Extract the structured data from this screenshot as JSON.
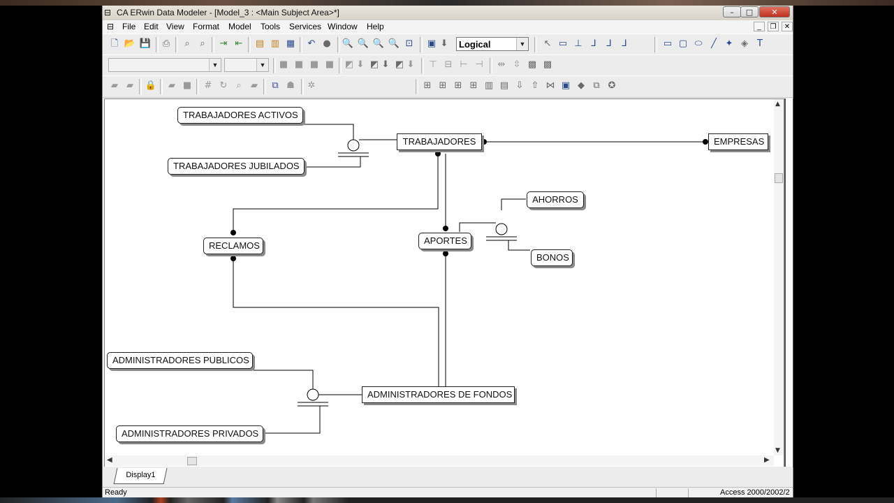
{
  "window": {
    "title": "CA ERwin Data Modeler - [Model_3 : <Main Subject Area>*]",
    "controls": {
      "minimize": "–",
      "maximize": "□",
      "close": "✕"
    }
  },
  "menu": [
    "File",
    "Edit",
    "View",
    "Format",
    "Model",
    "Tools",
    "Services",
    "Window",
    "Help"
  ],
  "toolbar": {
    "view_mode": "Logical",
    "font_combo": "",
    "size_combo": ""
  },
  "diagram": {
    "entities": {
      "trabajadores_activos": "TRABAJADORES ACTIVOS",
      "trabajadores_jubilados": "TRABAJADORES JUBILADOS",
      "trabajadores": "TRABAJADORES",
      "empresas": "EMPRESAS",
      "ahorros": "AHORROS",
      "bonos": "BONOS",
      "aportes": "APORTES",
      "reclamos": "RECLAMOS",
      "administradores_publicos": "ADMINISTRADORES PUBLICOS",
      "administradores_privados": "ADMINISTRADORES PRIVADOS",
      "administradores_de_fondos": "ADMINISTRADORES DE FONDOS"
    }
  },
  "tabs": [
    "Display1"
  ],
  "status": {
    "text": "Ready",
    "db": "Access 2000/2002/2"
  }
}
